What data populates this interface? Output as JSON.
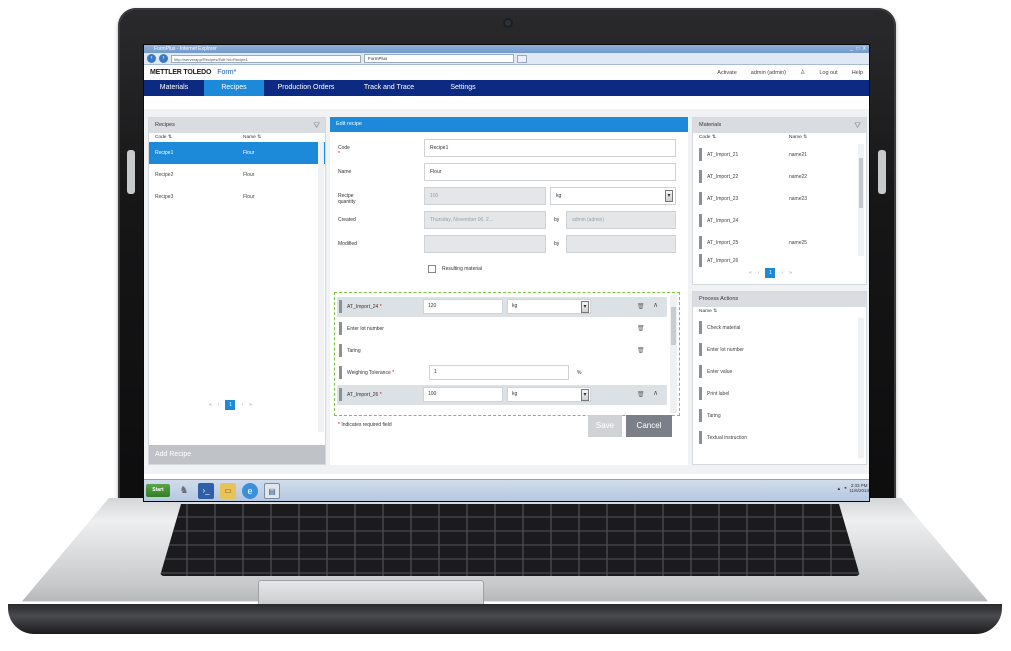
{
  "window": {
    "title": "FormPlus - Internet Explorer",
    "controls": "_ □ X",
    "address": "http://serverapp/Recipes/Edit?id=Recipe1",
    "tab_title": "FormPlus"
  },
  "header": {
    "brand": "METTLER TOLEDO",
    "product": "Form*",
    "right_links": [
      "Activate",
      "admin (admin)",
      "Log out",
      "Help"
    ]
  },
  "nav": {
    "tabs": [
      "Materials",
      "Recipes",
      "Production Orders",
      "Track and Trace",
      "Settings"
    ],
    "active": "Recipes"
  },
  "recipes_pane": {
    "title": "Recipes",
    "col_code": "Code",
    "col_name": "Name",
    "rows": [
      {
        "code": "Recipe1",
        "name": "Flour"
      },
      {
        "code": "Recipe2",
        "name": "Flour"
      },
      {
        "code": "Recipe3",
        "name": "Flour"
      }
    ],
    "page": "1",
    "add_button": "Add Recipe"
  },
  "edit_pane": {
    "title": "Edit recipe",
    "code_label": "Code",
    "code_value": "Recipe1",
    "name_label": "Name",
    "name_value": "Flour",
    "quantity_label": "Recipe quantity",
    "quantity_value": "100",
    "quantity_unit": "kg",
    "created_label": "Created",
    "created_value": "Thursday, November 06, 2...",
    "by_label": "by",
    "created_by": "admin (admin)",
    "modified_label": "Modified",
    "modified_value": "",
    "modified_by": "",
    "resulting_material_label": "Resulting material",
    "steps": {
      "mat1_label": "AT_Import_24",
      "mat1_qty": "120",
      "mat1_unit": "kg",
      "lot_label": "Enter lot number",
      "taring_label": "Taring",
      "tolerance_label": "Weighing Tolerance",
      "tolerance_value": "1",
      "tolerance_unit": "%",
      "mat2_label": "AT_Import_26",
      "mat2_qty": "100",
      "mat2_unit": "kg"
    },
    "required_note": "Indicates required field",
    "save_label": "Save",
    "cancel_label": "Cancel"
  },
  "materials_pane": {
    "title": "Materials",
    "col_code": "Code",
    "col_name": "Name",
    "rows": [
      {
        "code": "AT_Import_21",
        "name": "name21"
      },
      {
        "code": "AT_Import_22",
        "name": "name22"
      },
      {
        "code": "AT_Import_23",
        "name": "name23"
      },
      {
        "code": "AT_Import_24",
        "name": ""
      },
      {
        "code": "AT_Import_25",
        "name": "name25"
      },
      {
        "code": "AT_Import_26",
        "name": ""
      }
    ],
    "page": "1"
  },
  "process_pane": {
    "title": "Process Actions",
    "col_name": "Name",
    "rows": [
      "Check material",
      "Enter lot number",
      "Enter value",
      "Print label",
      "Taring",
      "Textual instruction"
    ]
  },
  "taskbar": {
    "start_label": "Start",
    "time": "2:33 PM",
    "date": "11/6/2013"
  }
}
